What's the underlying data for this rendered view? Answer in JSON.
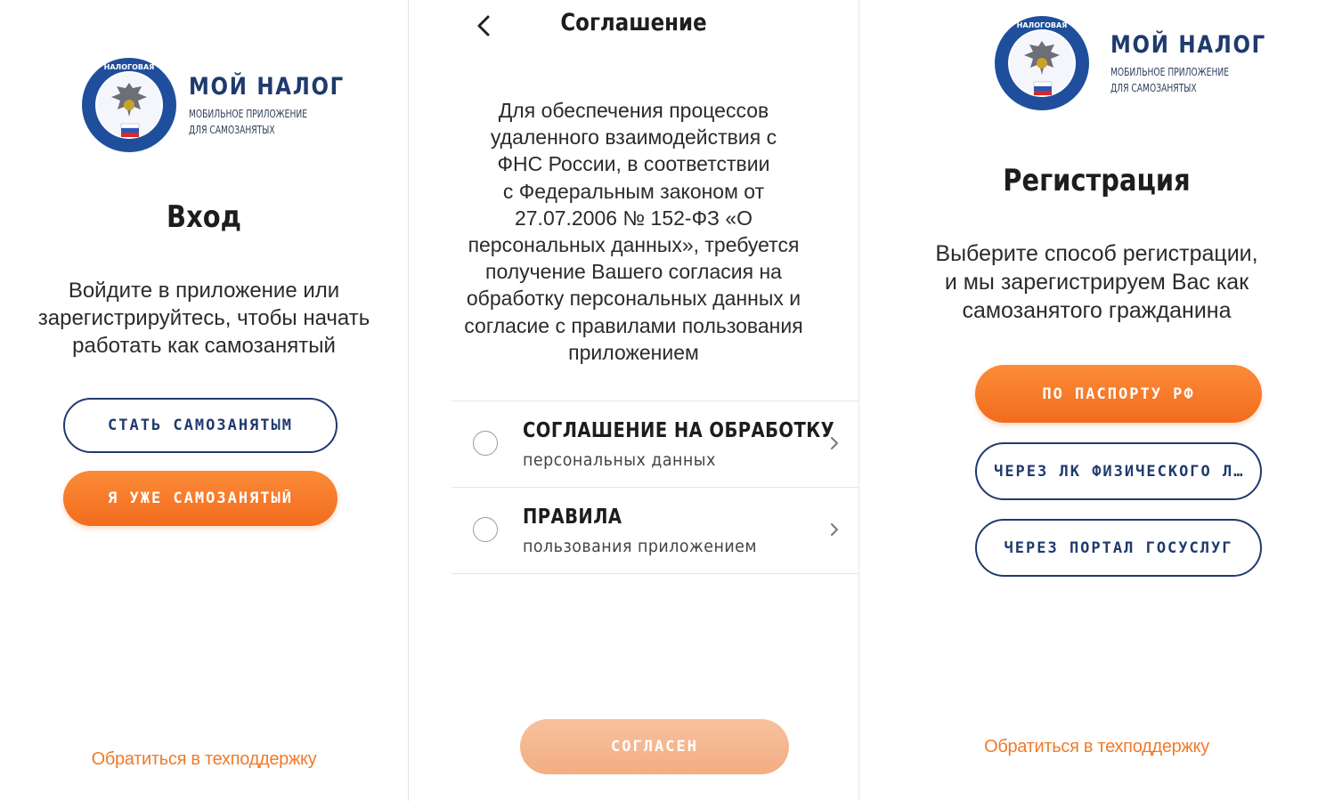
{
  "login": {
    "logo": {
      "title": "МОЙ НАЛОГ",
      "subtitle_line1": "МОБИЛЬНОЕ ПРИЛОЖЕНИЕ",
      "subtitle_line2": "ДЛЯ САМОЗАНЯТЫХ",
      "emblem_icon": "fns-emblem-icon"
    },
    "heading": "Вход",
    "description_lines": [
      "Войдите в приложение или",
      "зарегистрируйтесь, чтобы начать",
      "работать как самозанятый"
    ],
    "become_button": "СТАТЬ САМОЗАНЯТЫМ",
    "already_button": "Я УЖЕ САМОЗАНЯТЫЙ",
    "support_link": "Обратиться в техподдержку"
  },
  "agreement": {
    "nav_title": "Соглашение",
    "back_icon": "chevron-left-icon",
    "description_lines": [
      "Для обеспечения процессов",
      "удаленного взаимодействия с",
      "ФНС России, в соответствии",
      "с Федеральным законом от",
      "27.07.2006 № 152-ФЗ «О",
      "персональных данных», требуется",
      "получение Вашего согласия на",
      "обработку персональных данных и",
      "согласие с правилами пользования",
      "приложением"
    ],
    "items": [
      {
        "title": "СОГЛАШЕНИЕ НА ОБРАБОТКУ",
        "subtitle": "персональных данных"
      },
      {
        "title": "ПРАВИЛА",
        "subtitle": "пользования приложением"
      }
    ],
    "agree_button": "СОГЛАСЕН"
  },
  "registration": {
    "logo": {
      "title": "МОЙ НАЛОГ",
      "subtitle_line1": "МОБИЛЬНОЕ ПРИЛОЖЕНИЕ",
      "subtitle_line2": "ДЛЯ САМОЗАНЯТЫХ",
      "emblem_icon": "fns-emblem-icon"
    },
    "heading": "Регистрация",
    "description_lines": [
      "Выберите способ регистрации,",
      "и мы зарегистрируем Вас как",
      "самозанятого гражданина"
    ],
    "passport_button": "ПО ПАСПОРТУ РФ",
    "personal_account_button": "ЧЕРЕЗ ЛК ФИЗИЧЕСКОГО Л...",
    "gosuslugi_button": "ЧЕРЕЗ ПОРТАЛ ГОСУСЛУГ",
    "support_link": "Обратиться в техподдержку"
  },
  "colors": {
    "accent_orange": "#f26c1e",
    "brand_blue": "#1f3a6d",
    "link_orange": "#f07a2a",
    "disabled_orange": "#f3ad82"
  }
}
